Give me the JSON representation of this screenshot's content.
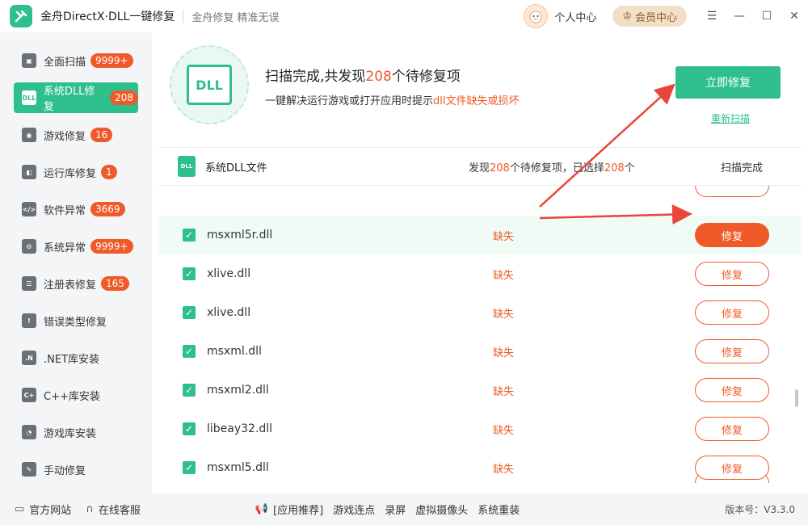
{
  "titlebar": {
    "app_name": "金舟DirectX·DLL一键修复",
    "slogan": "金舟修复 精准无误",
    "user_center": "个人中心",
    "vip_center": "会员中心",
    "controls": [
      "☰",
      "—",
      "☐",
      "✕"
    ]
  },
  "sidebar": {
    "items": [
      {
        "label": "全面扫描",
        "badge": "9999+",
        "icon": "full-scan-icon"
      },
      {
        "label": "系统DLL修复",
        "badge": "208",
        "icon": "dll-icon"
      },
      {
        "label": "游戏修复",
        "badge": "16",
        "icon": "gamepad-icon"
      },
      {
        "label": "运行库修复",
        "badge": "1",
        "icon": "runtime-icon"
      },
      {
        "label": "软件异常",
        "badge": "3669",
        "icon": "code-icon"
      },
      {
        "label": "系统异常",
        "badge": "9999+",
        "icon": "gear-icon"
      },
      {
        "label": "注册表修复",
        "badge": "165",
        "icon": "list-icon"
      },
      {
        "label": "错误类型修复",
        "badge": "",
        "icon": "warning-icon"
      },
      {
        "label": ".NET库安装",
        "badge": "",
        "icon": "dotnet-icon"
      },
      {
        "label": "C++库安装",
        "badge": "",
        "icon": "cpp-icon"
      },
      {
        "label": "游戏库安装",
        "badge": "",
        "icon": "pacman-icon"
      },
      {
        "label": "手动修复",
        "badge": "",
        "icon": "wrench-icon"
      }
    ],
    "active_index": 1
  },
  "hero": {
    "icon_text": "DLL",
    "title_pre": "扫描完成,共发现",
    "title_num": "208",
    "title_post": "个待修复项",
    "sub_pre": "一键解决运行游戏或打开应用时提示",
    "sub_highlight": "dll文件缺失或损坏",
    "fix_all_button": "立即修复",
    "rescan_link": "重新扫描"
  },
  "list_header": {
    "icon_text": "DLL",
    "title": "系统DLL文件",
    "summary_pre": "发现",
    "summary_found": "208",
    "summary_mid": "个待修复项，已选择",
    "summary_selected": "208",
    "summary_post": "个",
    "status": "扫描完成"
  },
  "rows": [
    {
      "file": "msxml5r.dll",
      "status": "缺失",
      "action": "修复",
      "highlighted": true
    },
    {
      "file": "xlive.dll",
      "status": "缺失",
      "action": "修复",
      "highlighted": false
    },
    {
      "file": "xlive.dll",
      "status": "缺失",
      "action": "修复",
      "highlighted": false
    },
    {
      "file": "msxml.dll",
      "status": "缺失",
      "action": "修复",
      "highlighted": false
    },
    {
      "file": "msxml2.dll",
      "status": "缺失",
      "action": "修复",
      "highlighted": false
    },
    {
      "file": "libeay32.dll",
      "status": "缺失",
      "action": "修复",
      "highlighted": false
    },
    {
      "file": "msxml5.dll",
      "status": "缺失",
      "action": "修复",
      "highlighted": false
    }
  ],
  "footer": {
    "official_site": "官方网站",
    "online_service": "在线客服",
    "recommend": "[应用推荐]",
    "links": [
      "游戏连点",
      "录屏",
      "虚拟摄像头",
      "系统重装"
    ],
    "version": "版本号：V3.3.0"
  },
  "colors": {
    "accent": "#2fbf8c",
    "warning": "#f05a28",
    "vip": "#f3dfc6"
  }
}
